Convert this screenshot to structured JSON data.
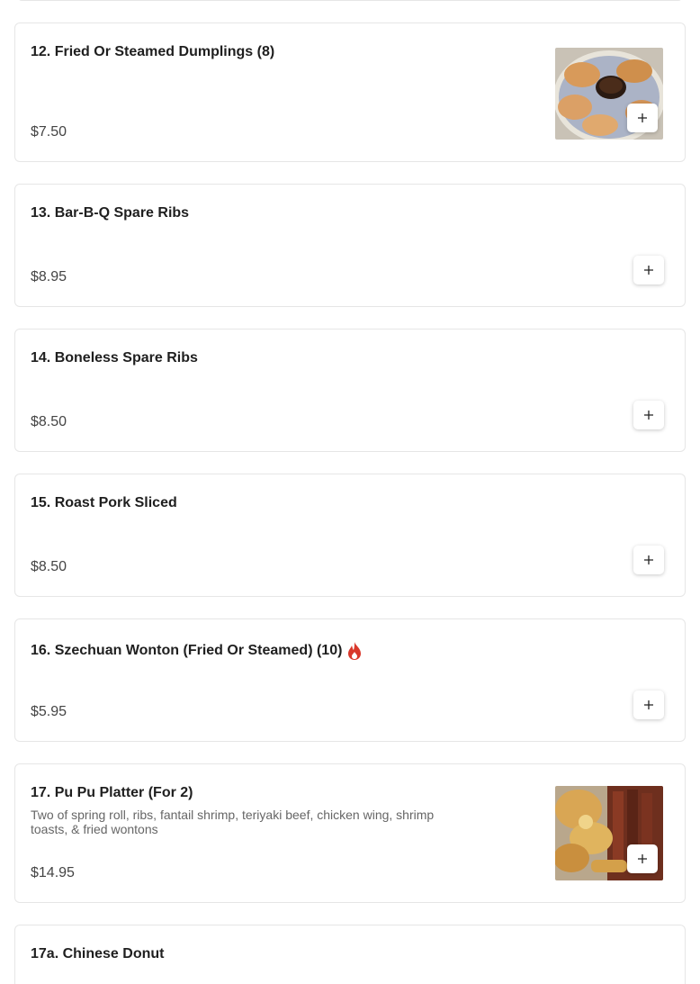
{
  "menu_items": [
    {
      "name": "12. Fried Or Steamed Dumplings (8)",
      "price": "$7.50",
      "image": "dumplings-photo"
    },
    {
      "name": "13. Bar-B-Q Spare Ribs",
      "price": "$8.95"
    },
    {
      "name": "14. Boneless Spare Ribs",
      "price": "$8.50"
    },
    {
      "name": "15. Roast Pork Sliced",
      "price": "$8.50"
    },
    {
      "name": "16. Szechuan Wonton (Fried Or Steamed) (10)",
      "price": "$5.95",
      "badge": "spicy-flame-icon"
    },
    {
      "name": "17. Pu Pu Platter (For 2)",
      "description": "Two of spring roll, ribs, fantail shrimp, teriyaki beef, chicken wing, shrimp toasts, & fried wontons",
      "price": "$14.95",
      "image": "pu-pu-platter-photo"
    },
    {
      "name": "17a. Chinese Donut"
    }
  ],
  "add_button_icon": "plus-icon",
  "colors": {
    "card_border": "#e6e6e6",
    "spicy_icon": "#d9382b"
  }
}
